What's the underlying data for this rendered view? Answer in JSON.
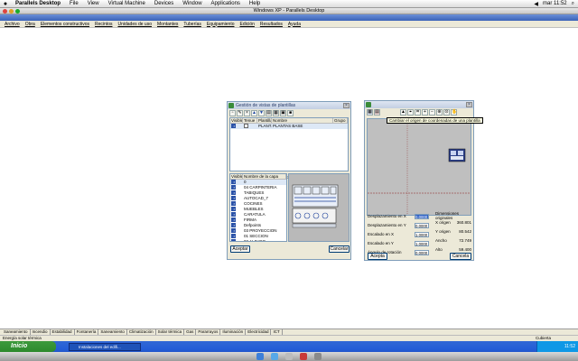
{
  "mac_menu": {
    "app": "Parallels Desktop",
    "items": [
      "File",
      "View",
      "Virtual Machine",
      "Devices",
      "Window",
      "Applications",
      "Help"
    ],
    "clock": "mar 11:52"
  },
  "xp_window_title": "Windows XP - Parallels Desktop",
  "app_menu": [
    "Archivo",
    "Obra",
    "Elementos constructivos",
    "Recintos",
    "Unidades de uso",
    "Montantes",
    "Tuberías",
    "Equipamiento",
    "Edición",
    "Resultados",
    "Ayuda"
  ],
  "dialog_plants": {
    "title": "Gestión de vistas de plantillas",
    "columns": [
      "Visible",
      "Tenue",
      "Plantilla",
      "Nombre",
      "Grupo"
    ],
    "rows": [
      {
        "plantilla": "PLANT...",
        "nombre": "PLANTAS BASE"
      }
    ],
    "layers_label": "Capas de la vista",
    "layers_view": "PLANTAS BASE",
    "layer_columns": [
      "Visible",
      "Nombre de la capa"
    ],
    "layers": [
      "0",
      "04 CARPINTERIA",
      "TABIQUES",
      "AUTOCAD_7",
      "COCINES",
      "MUEBLES",
      "CARATULA",
      "FIRMA",
      "Defpoints",
      "03 PROYECCION",
      "01 SECCION",
      "02 ALZADO"
    ],
    "accept": "Aceptar",
    "cancel": "Cancelar"
  },
  "dialog_origin": {
    "tooltip": "Cambiar el origen de coordenadas de una plantilla",
    "fields": [
      {
        "label": "Desplazamiento en X",
        "value": "0.0000"
      },
      {
        "label": "Desplazamiento en Y",
        "value": "0.0000"
      },
      {
        "label": "Escalado en X",
        "value": "1.0000"
      },
      {
        "label": "Escalado en Y",
        "value": "1.0000"
      },
      {
        "label": "Ángulo de rotación",
        "value": "0.0000"
      }
    ],
    "dims_title": "Dimensiones originales",
    "dims": [
      {
        "label": "X origen",
        "value": "360.801"
      },
      {
        "label": "Y origen",
        "value": "80.542"
      },
      {
        "label": "Ancho",
        "value": "72.749"
      },
      {
        "label": "Alto",
        "value": "59.400"
      }
    ],
    "accept": "Acepta",
    "cancel": "Cancela"
  },
  "bottom_tabs": [
    "Saneamiento",
    "Incendio",
    "Estabilidad",
    "Fontanería",
    "Saneamiento",
    "Climatización",
    "Solar térmica",
    "Gas",
    "Pararrayos",
    "Iluminación",
    "Electricidad",
    "ICT"
  ],
  "status_text": "Energía solar térmica",
  "status_right": "Cubierta",
  "taskbar": {
    "start": "Inicio",
    "task": "Instalaciones del edifi...",
    "tray_time": "11:52"
  }
}
